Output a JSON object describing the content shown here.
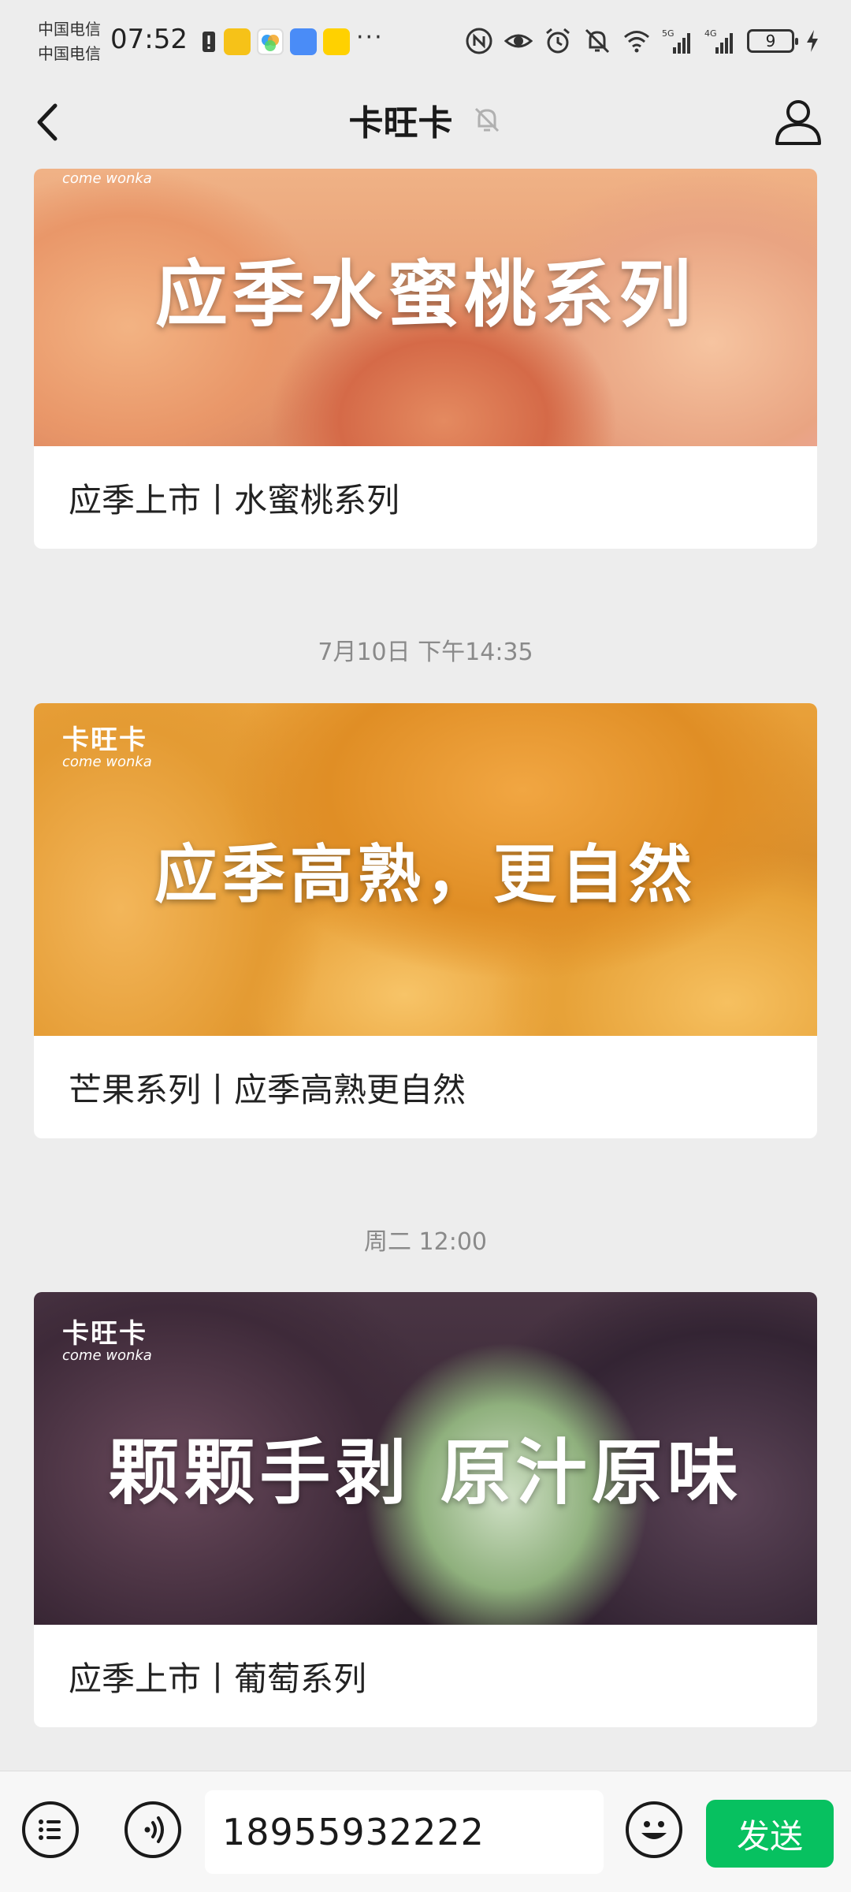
{
  "status_bar": {
    "carrier_1": "中国电信",
    "carrier_2": "中国电信",
    "time": "07:52",
    "more": "···",
    "battery": "9",
    "icons": [
      "alert-icon",
      "app-taobao-icon",
      "app-photos-icon",
      "app-mail-icon",
      "app-meituan-icon",
      "nfc-icon",
      "eye-icon",
      "alarm-icon",
      "mute-bell-icon",
      "wifi-icon",
      "signal-5g-icon",
      "signal-4g-icon",
      "charging-icon"
    ]
  },
  "header": {
    "title": "卡旺卡",
    "back_icon": "chevron-left-icon",
    "mute_icon": "bell-off-icon",
    "profile_icon": "person-icon"
  },
  "feed": [
    {
      "timestamp": "",
      "image_headline": "应季水蜜桃系列",
      "image_brand_cn": "",
      "image_brand_en": "come wonka",
      "caption": "应季上市丨水蜜桃系列"
    },
    {
      "timestamp": "7月10日 下午14:35",
      "image_headline": "应季高熟，更自然",
      "image_brand_cn": "卡旺卡",
      "image_brand_en": "come wonka",
      "caption": "芒果系列丨应季高熟更自然"
    },
    {
      "timestamp": "周二 12:00",
      "image_headline": "颗颗手剥 原汁原味",
      "image_brand_cn": "卡旺卡",
      "image_brand_en": "come wonka",
      "caption": "应季上市丨葡萄系列"
    }
  ],
  "input_bar": {
    "menu_icon": "list-menu-icon",
    "voice_icon": "voice-icon",
    "text_value": "18955932222",
    "emoji_icon": "emoji-icon",
    "send_label": "发送"
  },
  "colors": {
    "background": "#ededed",
    "send_button": "#07c160"
  }
}
